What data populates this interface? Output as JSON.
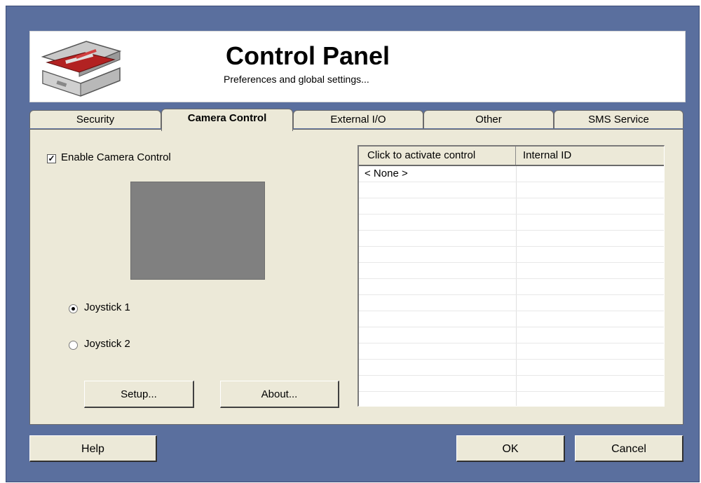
{
  "header": {
    "title": "Control Panel",
    "subtitle": "Preferences and global settings..."
  },
  "tabs": [
    {
      "label": "Security",
      "active": false
    },
    {
      "label": "Camera Control",
      "active": true
    },
    {
      "label": "External I/O",
      "active": false
    },
    {
      "label": "Other",
      "active": false
    },
    {
      "label": "SMS Service",
      "active": false
    }
  ],
  "camera": {
    "enable_label": "Enable Camera Control",
    "enable_checked": true,
    "check_glyph": "✓",
    "joystick1_label": "Joystick 1",
    "joystick2_label": "Joystick 2",
    "selected_joystick": 1,
    "setup_label": "Setup...",
    "about_label": "About..."
  },
  "control_list": {
    "columns": [
      "Click to activate control",
      "Internal ID"
    ],
    "rows": [
      {
        "control": "< None >",
        "id": ""
      }
    ]
  },
  "footer": {
    "help_label": "Help",
    "ok_label": "OK",
    "cancel_label": "Cancel"
  },
  "icons": {
    "logo": "toolbox-icon"
  }
}
